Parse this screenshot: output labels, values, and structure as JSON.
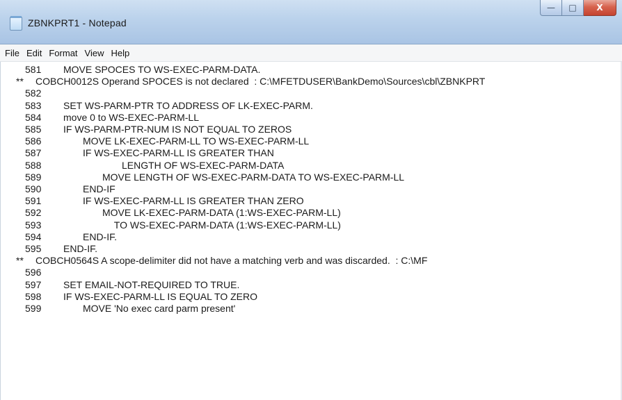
{
  "window": {
    "title": "ZBNKPRT1 - Notepad",
    "buttons": {
      "minimize": "—",
      "maximize": "□",
      "close": "X"
    }
  },
  "menu": [
    "File",
    "Edit",
    "Format",
    "View",
    "Help"
  ],
  "lines": [
    {
      "marker": "",
      "num": "581",
      "text": "MOVE SPOCES TO WS-EXEC-PARM-DATA.",
      "indent": 0
    },
    {
      "marker": "**",
      "num": "",
      "text": "COBCH0012S Operand SPOCES is not declared  : C:\\MFETDUSER\\BankDemo\\Sources\\cbl\\ZBNKPRT",
      "indent": 0,
      "message": true
    },
    {
      "marker": "",
      "num": "582",
      "text": "",
      "indent": 0
    },
    {
      "marker": "",
      "num": "583",
      "text": "SET WS-PARM-PTR TO ADDRESS OF LK-EXEC-PARM.",
      "indent": 0
    },
    {
      "marker": "",
      "num": "584",
      "text": "move 0 to WS-EXEC-PARM-LL",
      "indent": 0
    },
    {
      "marker": "",
      "num": "585",
      "text": "IF WS-PARM-PTR-NUM IS NOT EQUAL TO ZEROS",
      "indent": 0
    },
    {
      "marker": "",
      "num": "586",
      "text": "MOVE LK-EXEC-PARM-LL TO WS-EXEC-PARM-LL",
      "indent": 1
    },
    {
      "marker": "",
      "num": "587",
      "text": "IF WS-EXEC-PARM-LL IS GREATER THAN",
      "indent": 1
    },
    {
      "marker": "",
      "num": "588",
      "text": "LENGTH OF WS-EXEC-PARM-DATA",
      "indent": 3
    },
    {
      "marker": "",
      "num": "589",
      "text": "MOVE LENGTH OF WS-EXEC-PARM-DATA TO WS-EXEC-PARM-LL",
      "indent": 2
    },
    {
      "marker": "",
      "num": "590",
      "text": "END-IF",
      "indent": 1
    },
    {
      "marker": "",
      "num": "591",
      "text": "IF WS-EXEC-PARM-LL IS GREATER THAN ZERO",
      "indent": 1
    },
    {
      "marker": "",
      "num": "592",
      "text": "MOVE LK-EXEC-PARM-DATA (1:WS-EXEC-PARM-LL)",
      "indent": 2
    },
    {
      "marker": "",
      "num": "593",
      "text": "TO WS-EXEC-PARM-DATA (1:WS-EXEC-PARM-LL)",
      "indent": 2.6
    },
    {
      "marker": "",
      "num": "594",
      "text": "END-IF.",
      "indent": 1
    },
    {
      "marker": "",
      "num": "595",
      "text": "END-IF.",
      "indent": 0
    },
    {
      "marker": "**",
      "num": "",
      "text": "COBCH0564S A scope-delimiter did not have a matching verb and was discarded.  : C:\\MF",
      "indent": 0,
      "message": true
    },
    {
      "marker": "",
      "num": "596",
      "text": "",
      "indent": 0
    },
    {
      "marker": "",
      "num": "597",
      "text": "SET EMAIL-NOT-REQUIRED TO TRUE.",
      "indent": 0
    },
    {
      "marker": "",
      "num": "598",
      "text": "IF WS-EXEC-PARM-LL IS EQUAL TO ZERO",
      "indent": 0
    },
    {
      "marker": "",
      "num": "599",
      "text": "MOVE 'No exec card parm present'",
      "indent": 1
    }
  ]
}
